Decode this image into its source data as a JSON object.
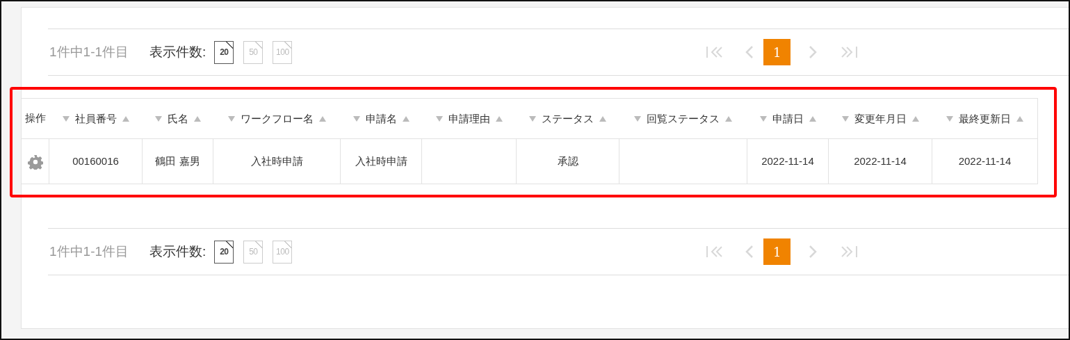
{
  "pagers": [
    {
      "range_text": "1件中1-1件目",
      "page_size_label": "表示件数:",
      "page_sizes": [
        {
          "label": "20",
          "selected": true
        },
        {
          "label": "50",
          "selected": false
        },
        {
          "label": "100",
          "selected": false
        }
      ],
      "nav": [
        {
          "kind": "first",
          "disabled": true
        },
        {
          "kind": "prev",
          "disabled": true
        },
        {
          "kind": "page",
          "label": "1",
          "selected": true
        },
        {
          "kind": "next",
          "disabled": true
        },
        {
          "kind": "last",
          "disabled": true
        }
      ]
    },
    {
      "range_text": "1件中1-1件目",
      "page_size_label": "表示件数:",
      "page_sizes": [
        {
          "label": "20",
          "selected": true
        },
        {
          "label": "50",
          "selected": false
        },
        {
          "label": "100",
          "selected": false
        }
      ],
      "nav": [
        {
          "kind": "first",
          "disabled": true
        },
        {
          "kind": "prev",
          "disabled": true
        },
        {
          "kind": "page",
          "label": "1",
          "selected": true
        },
        {
          "kind": "next",
          "disabled": true
        },
        {
          "kind": "last",
          "disabled": true
        }
      ]
    }
  ],
  "table": {
    "columns": [
      {
        "label": "操作",
        "sortable": false
      },
      {
        "label": "社員番号",
        "sortable": true
      },
      {
        "label": "氏名",
        "sortable": true
      },
      {
        "label": "ワークフロー名",
        "sortable": true
      },
      {
        "label": "申請名",
        "sortable": true
      },
      {
        "label": "申請理由",
        "sortable": true
      },
      {
        "label": "ステータス",
        "sortable": true
      },
      {
        "label": "回覧ステータス",
        "sortable": true
      },
      {
        "label": "申請日",
        "sortable": true
      },
      {
        "label": "変更年月日",
        "sortable": true
      },
      {
        "label": "最終更新日",
        "sortable": true
      }
    ],
    "rows": [
      {
        "cells": [
          null,
          "00160016",
          "鶴田 嘉男",
          "入社時申請",
          "入社時申請",
          null,
          "承認",
          null,
          "2022-11-14",
          "2022-11-14",
          "2022-11-14"
        ]
      }
    ]
  }
}
